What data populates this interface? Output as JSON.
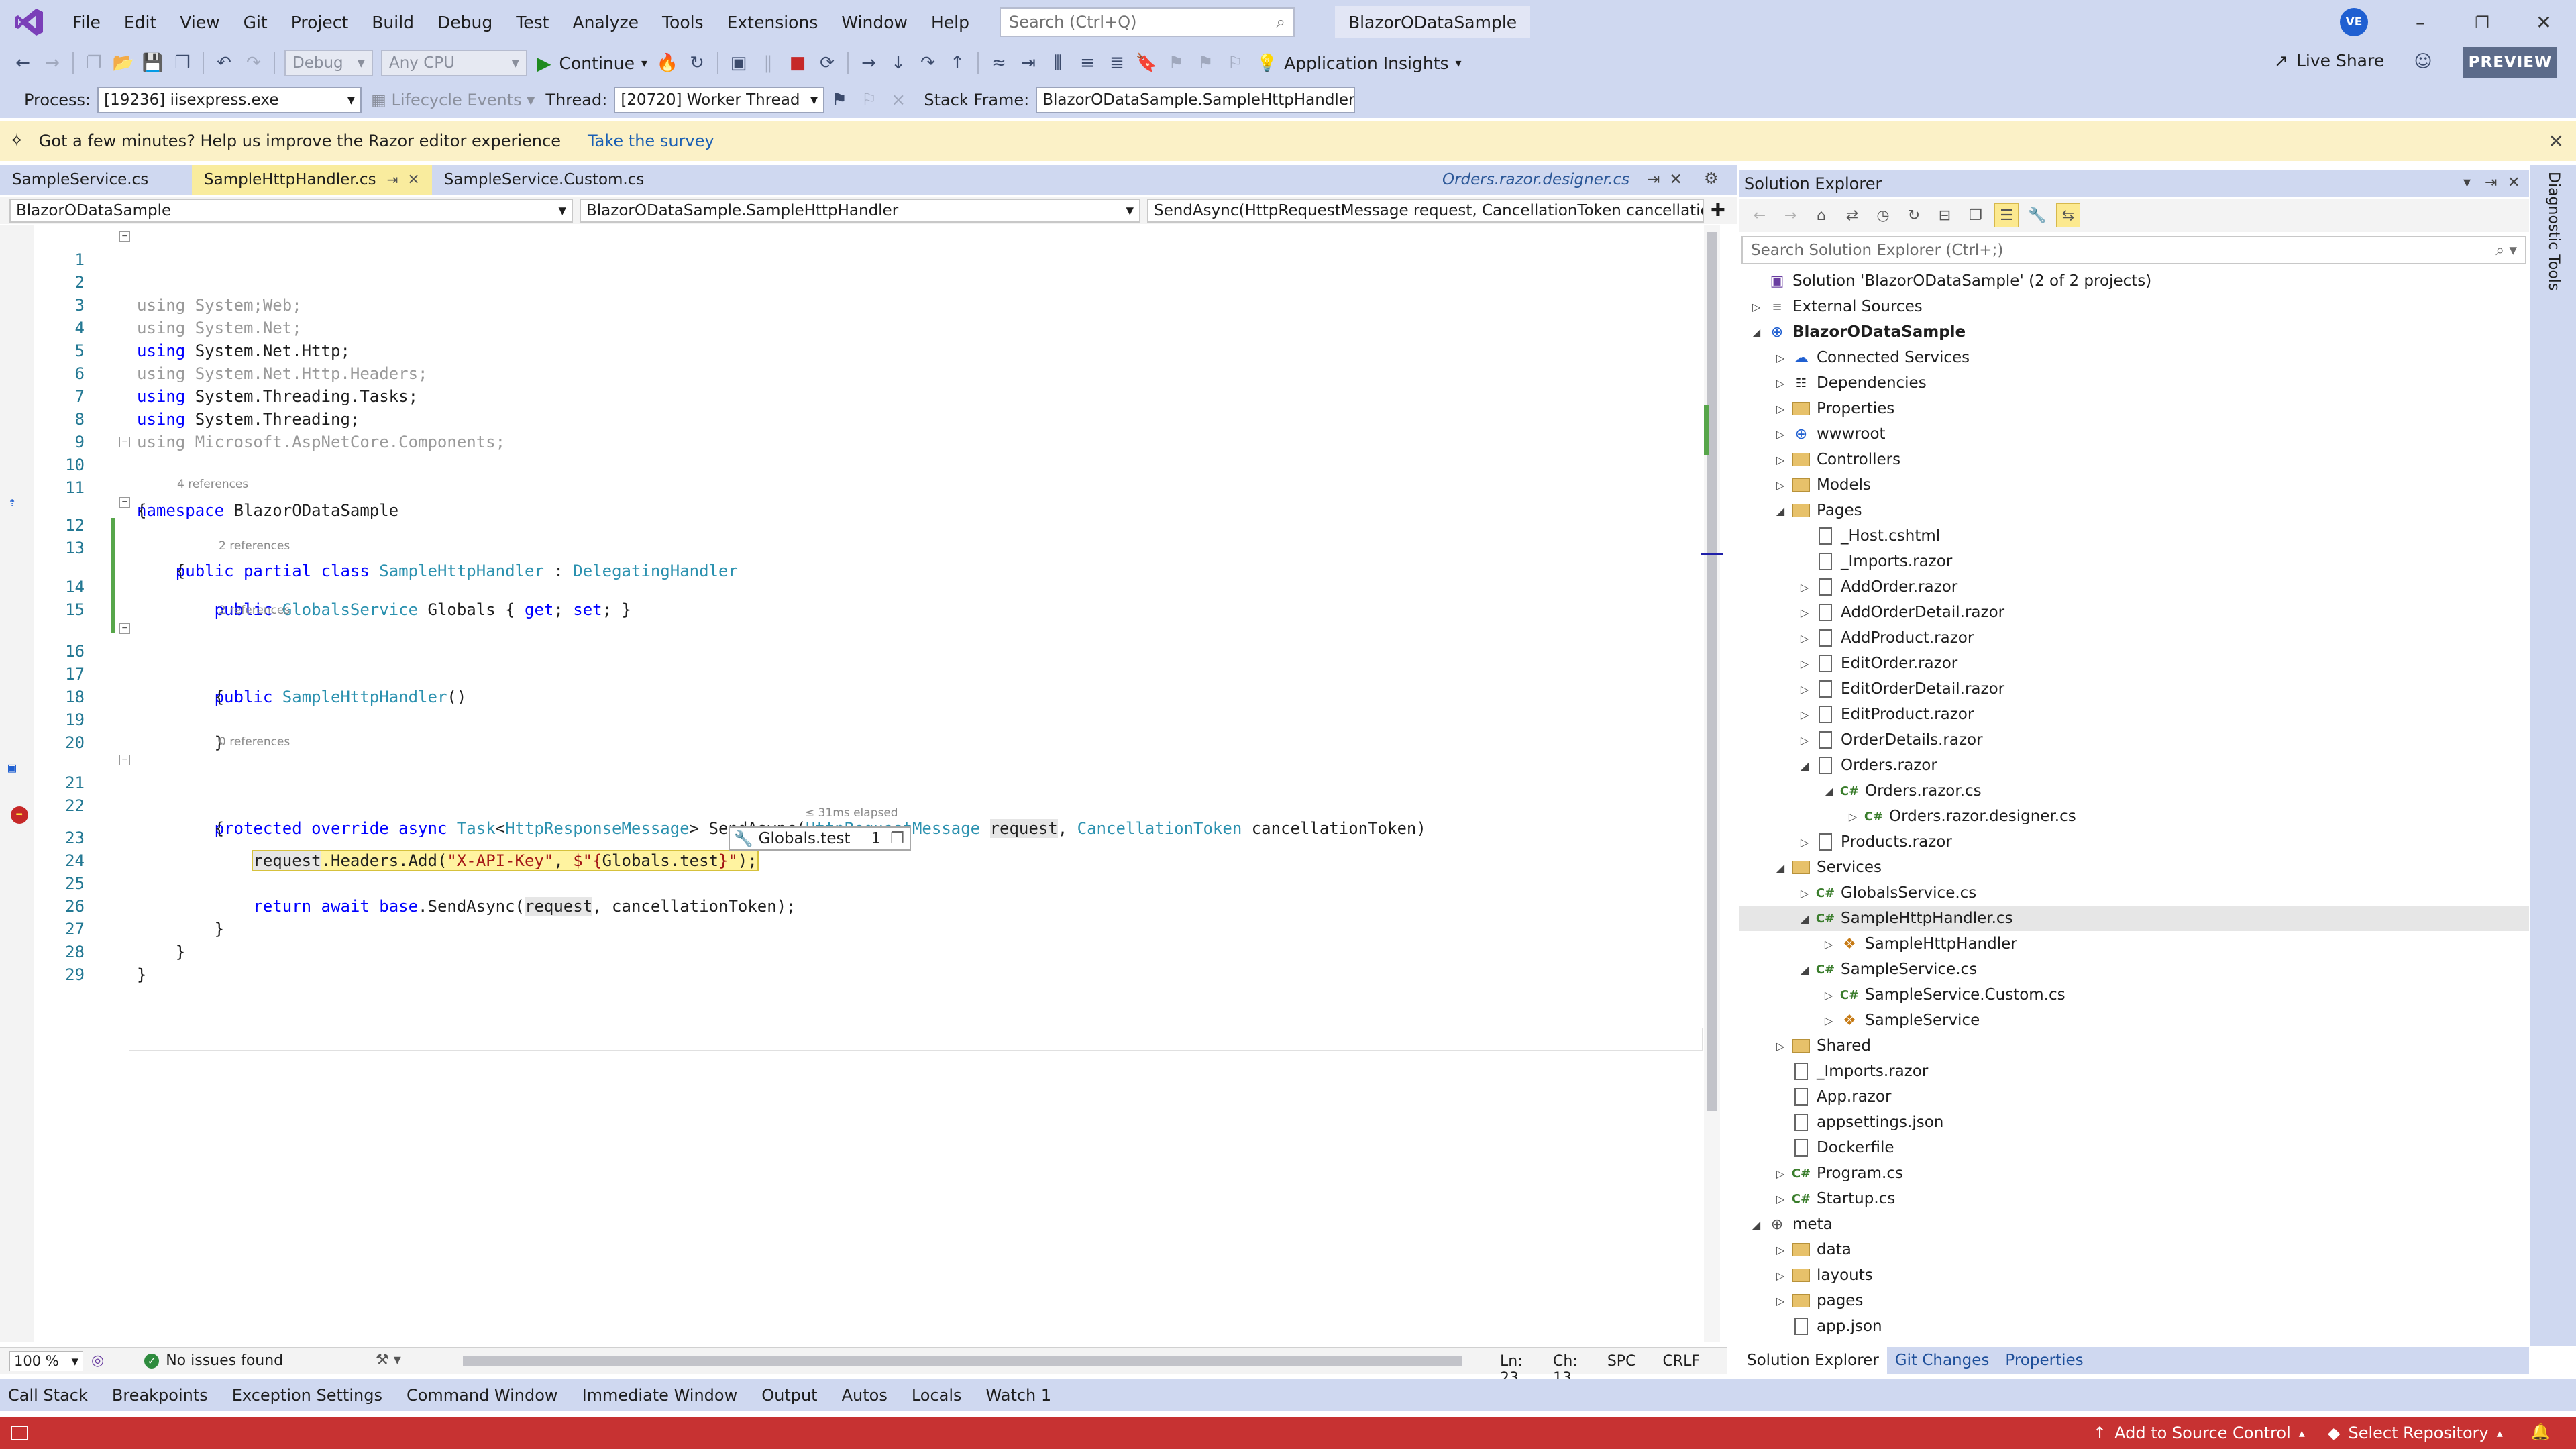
{
  "menu": {
    "items": [
      "File",
      "Edit",
      "View",
      "Git",
      "Project",
      "Build",
      "Debug",
      "Test",
      "Analyze",
      "Tools",
      "Extensions",
      "Window",
      "Help"
    ],
    "search_placeholder": "Search (Ctrl+Q)",
    "solution_name": "BlazorODataSample",
    "avatar_initials": "VE"
  },
  "toolbar": {
    "config": "Debug",
    "platform": "Any CPU",
    "continue_label": "Continue",
    "app_insights_label": "Application Insights",
    "live_share_label": "Live Share",
    "preview_label": "PREVIEW"
  },
  "debug_location": {
    "process_label": "Process:",
    "process_value": "[19236] iisexpress.exe",
    "lifecycle_label": "Lifecycle Events",
    "thread_label": "Thread:",
    "thread_value": "[20720] Worker Thread",
    "stack_frame_label": "Stack Frame:",
    "stack_frame_value": "BlazorODataSample.SampleHttpHandler.S"
  },
  "infobar": {
    "message": "Got a few minutes? Help us improve the Razor editor experience",
    "link": "Take the survey"
  },
  "doc_tabs": {
    "tabs": [
      {
        "label": "SampleService.cs"
      },
      {
        "label": "SampleHttpHandler.cs"
      },
      {
        "label": "SampleService.Custom.cs"
      }
    ],
    "preview_tab": "Orders.razor.designer.cs"
  },
  "navbar": {
    "project": "BlazorODataSample",
    "type": "BlazorODataSample.SampleHttpHandler",
    "member": "SendAsync(HttpRequestMessage request, CancellationToken cancellatio"
  },
  "code": {
    "codelens": {
      "l12": "4 references",
      "l14": "2 references",
      "l16": "2 references",
      "l21": "0 references"
    },
    "datatip_name": "Globals.test",
    "datatip_value": "1",
    "perf_tip": "≤ 31ms elapsed"
  },
  "editor_status": {
    "zoom": "100 %",
    "issues": "No issues found",
    "line": "Ln: 23",
    "col": "Ch: 13",
    "spc": "SPC",
    "crlf": "CRLF"
  },
  "solution_explorer": {
    "title": "Solution Explorer",
    "search_placeholder": "Search Solution Explorer (Ctrl+;)",
    "items": [
      {
        "label": "Solution 'BlazorODataSample' (2 of 2 projects)"
      },
      {
        "label": "External Sources"
      },
      {
        "label": "BlazorODataSample"
      },
      {
        "label": "Connected Services"
      },
      {
        "label": "Dependencies"
      },
      {
        "label": "Properties"
      },
      {
        "label": "wwwroot"
      },
      {
        "label": "Controllers"
      },
      {
        "label": "Models"
      },
      {
        "label": "Pages"
      },
      {
        "label": "_Host.cshtml"
      },
      {
        "label": "_Imports.razor"
      },
      {
        "label": "AddOrder.razor"
      },
      {
        "label": "AddOrderDetail.razor"
      },
      {
        "label": "AddProduct.razor"
      },
      {
        "label": "EditOrder.razor"
      },
      {
        "label": "EditOrderDetail.razor"
      },
      {
        "label": "EditProduct.razor"
      },
      {
        "label": "OrderDetails.razor"
      },
      {
        "label": "Orders.razor"
      },
      {
        "label": "Orders.razor.cs"
      },
      {
        "label": "Orders.razor.designer.cs"
      },
      {
        "label": "Products.razor"
      },
      {
        "label": "Services"
      },
      {
        "label": "GlobalsService.cs"
      },
      {
        "label": "SampleHttpHandler.cs"
      },
      {
        "label": "SampleHttpHandler"
      },
      {
        "label": "SampleService.cs"
      },
      {
        "label": "SampleService.Custom.cs"
      },
      {
        "label": "SampleService"
      },
      {
        "label": "Shared"
      },
      {
        "label": "_Imports.razor"
      },
      {
        "label": "App.razor"
      },
      {
        "label": "appsettings.json"
      },
      {
        "label": "Dockerfile"
      },
      {
        "label": "Program.cs"
      },
      {
        "label": "Startup.cs"
      },
      {
        "label": "meta"
      },
      {
        "label": "data"
      },
      {
        "label": "layouts"
      },
      {
        "label": "pages"
      },
      {
        "label": "app.json"
      }
    ],
    "bottom_tabs": [
      "Solution Explorer",
      "Git Changes",
      "Properties"
    ],
    "side_tool": "Diagnostic Tools"
  },
  "tool_windows": [
    "Call Stack",
    "Breakpoints",
    "Exception Settings",
    "Command Window",
    "Immediate Window",
    "Output",
    "Autos",
    "Locals",
    "Watch 1"
  ],
  "statusbar": {
    "add_source": "Add to Source Control",
    "select_repo": "Select Repository"
  },
  "icons": {
    "logo": "visual-studio-logo",
    "search": "search-icon",
    "breakpoint": "breakpoint-current-icon",
    "accent": "#c73232"
  }
}
